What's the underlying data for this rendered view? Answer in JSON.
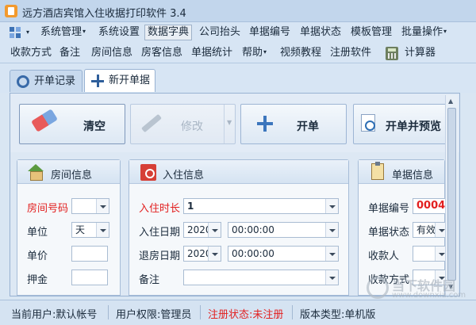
{
  "window": {
    "title": "远方酒店宾馆入住收据打印软件 3.4"
  },
  "menu1": [
    {
      "label": "系统管理",
      "has_caret": true
    },
    {
      "label": "系统设置"
    },
    {
      "label": "数据字典",
      "active": true
    },
    {
      "label": "公司抬头"
    },
    {
      "label": "单据编号"
    },
    {
      "label": "单据状态"
    },
    {
      "label": "模板管理"
    },
    {
      "label": "批量操作",
      "has_caret": true
    }
  ],
  "menu2": [
    {
      "label": "收款方式"
    },
    {
      "label": "备注"
    },
    {
      "label": "房间信息"
    },
    {
      "label": "房客信息"
    },
    {
      "label": "单据统计"
    },
    {
      "label": "帮助",
      "has_caret": true
    },
    {
      "label": "视频教程"
    },
    {
      "label": "注册软件"
    },
    {
      "label": "计算器"
    }
  ],
  "tabs": [
    {
      "label": "开单记录",
      "active": false
    },
    {
      "label": "新开单据",
      "active": true
    }
  ],
  "toolbar": {
    "clear": "清空",
    "modify": "修改",
    "open": "开单",
    "open_preview": "开单并预览"
  },
  "room_panel": {
    "title": "房间信息",
    "room_no_label": "房间号码",
    "room_no_value": "",
    "unit_label": "单位",
    "unit_value": "天",
    "price_label": "单价",
    "price_value": "",
    "deposit_label": "押金",
    "deposit_value": ""
  },
  "checkin_panel": {
    "title": "入住信息",
    "duration_label": "入住时长",
    "duration_value": "1",
    "checkin_label": "入住日期",
    "checkin_date": "2020",
    "checkin_time": "00:00:00",
    "checkout_label": "退房日期",
    "checkout_date": "2020",
    "checkout_time": "00:00:00",
    "remark_label": "备注",
    "remark_value": ""
  },
  "bill_panel": {
    "title": "单据信息",
    "bill_no_label": "单据编号",
    "bill_no_value": "0004",
    "status_label": "单据状态",
    "status_value": "有效",
    "payee_label": "收款人",
    "payee_value": "",
    "payment_label": "收款方式",
    "payment_value": ""
  },
  "statusbar": {
    "user": "当前用户:默认帐号",
    "permission": "用户权限:管理员",
    "registration": "注册状态:未注册",
    "version": "版本类型:单机版"
  },
  "watermark": {
    "text": "当下软件园",
    "url": "www.downxia.com"
  },
  "colors": {
    "accent_red": "#e21f1f",
    "chrome_blue": "#d7e5f4"
  }
}
